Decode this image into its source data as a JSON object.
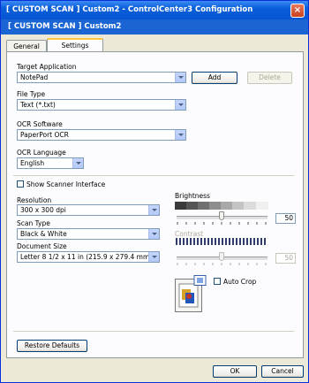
{
  "window": {
    "title": "[  CUSTOM SCAN  ]   Custom2 - ControlCenter3 Configuration",
    "header": "[  CUSTOM SCAN  ]    Custom2"
  },
  "tabs": [
    {
      "label": "General"
    },
    {
      "label": "Settings"
    }
  ],
  "target_application": {
    "label": "Target Application",
    "value": "NotePad",
    "add_label": "Add",
    "delete_label": "Delete"
  },
  "file_type": {
    "label": "File Type",
    "value": "Text (*.txt)"
  },
  "ocr_software": {
    "label": "OCR Software",
    "value": "PaperPort OCR"
  },
  "ocr_language": {
    "label": "OCR Language",
    "value": "English"
  },
  "show_scanner_interface": {
    "label": "Show Scanner Interface",
    "checked": false
  },
  "resolution": {
    "label": "Resolution",
    "value": "300 x 300 dpi"
  },
  "scan_type": {
    "label": "Scan Type",
    "value": "Black & White"
  },
  "document_size": {
    "label": "Document Size",
    "value": "Letter 8 1/2 x 11 in (215.9 x 279.4 mm)"
  },
  "brightness": {
    "label": "Brightness",
    "value": "50"
  },
  "contrast": {
    "label": "Contrast",
    "value": "50"
  },
  "auto_crop": {
    "label": "Auto Crop",
    "checked": false
  },
  "footer": {
    "restore_label": "Restore Defaults",
    "ok_label": "OK",
    "cancel_label": "Cancel"
  },
  "icons": {
    "close": "close-icon",
    "dropdown": "chevron-down-icon",
    "preview": "scan-preview-icon"
  }
}
